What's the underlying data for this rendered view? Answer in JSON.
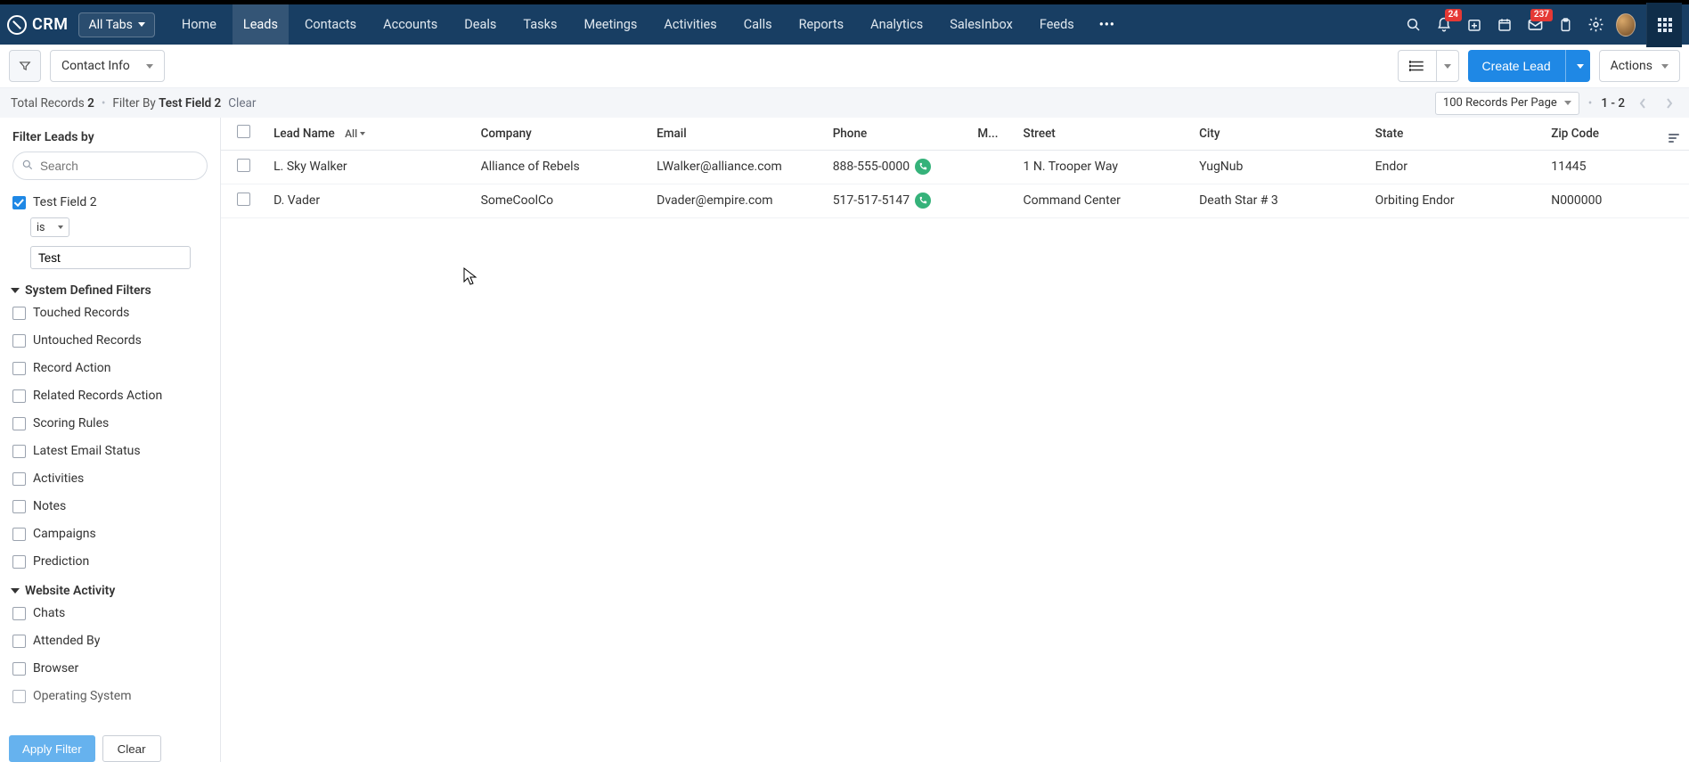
{
  "app": {
    "name": "CRM"
  },
  "nav": {
    "alltabs_label": "All Tabs",
    "items": [
      "Home",
      "Leads",
      "Contacts",
      "Accounts",
      "Deals",
      "Tasks",
      "Meetings",
      "Activities",
      "Calls",
      "Reports",
      "Analytics",
      "SalesInbox",
      "Feeds"
    ],
    "active_index": 1,
    "more_label": "•••"
  },
  "top_icons": {
    "bell_badge": "24",
    "cart_badge": "237"
  },
  "toolbar": {
    "view_name": "Contact Info",
    "create_label": "Create Lead",
    "actions_label": "Actions"
  },
  "summary": {
    "total_label": "Total Records",
    "total_count": "2",
    "filterby_label": "Filter By",
    "filter_value": "Test Field 2",
    "clear_label": "Clear",
    "rpp_label": "100 Records Per Page",
    "range": "1 - 2"
  },
  "filters": {
    "panel_title": "Filter Leads by",
    "search_placeholder": "Search",
    "field1": {
      "label": "Test Field 2",
      "operator": "is",
      "value": "Test"
    },
    "sys_section": "System Defined Filters",
    "sys_items": [
      "Touched Records",
      "Untouched Records",
      "Record Action",
      "Related Records Action",
      "Scoring Rules",
      "Latest Email Status",
      "Activities",
      "Notes",
      "Campaigns",
      "Prediction"
    ],
    "web_section": "Website Activity",
    "web_items": [
      "Chats",
      "Attended By",
      "Browser",
      "Operating System"
    ],
    "apply_label": "Apply Filter",
    "clear_label": "Clear"
  },
  "table": {
    "headers": {
      "lead_name": "Lead Name",
      "lead_name_sub": "All",
      "company": "Company",
      "email": "Email",
      "phone": "Phone",
      "m": "M...",
      "street": "Street",
      "city": "City",
      "state": "State",
      "zip": "Zip Code"
    },
    "rows": [
      {
        "lead_name": "L. Sky Walker",
        "company": "Alliance of Rebels",
        "email": "LWalker@alliance.com",
        "phone": "888-555-0000",
        "m": "",
        "street": "1 N. Trooper Way",
        "city": "YugNub",
        "state": "Endor",
        "zip": "11445"
      },
      {
        "lead_name": "D. Vader",
        "company": "SomeCoolCo",
        "email": "Dvader@empire.com",
        "phone": "517-517-5147",
        "m": "",
        "street": "Command Center",
        "city": "Death Star # 3",
        "state": "Orbiting Endor",
        "zip": "N000000"
      }
    ]
  }
}
